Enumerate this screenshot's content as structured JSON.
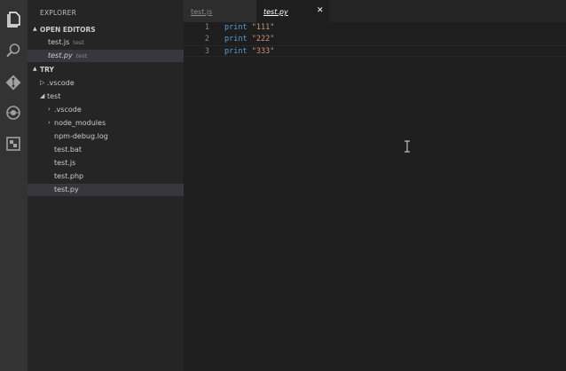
{
  "explorer": {
    "title": "EXPLORER",
    "open_editors_label": "OPEN EDITORS",
    "open_editors": [
      {
        "name": "test.js",
        "folder": "test"
      },
      {
        "name": "test.py",
        "folder": "test"
      }
    ],
    "workspace_label": "TRY",
    "tree": {
      "vscode_root": ".vscode",
      "test_folder": "test",
      "vscode_sub": ".vscode",
      "node_modules": "node_modules",
      "files": [
        "npm-debug.log",
        "test.bat",
        "test.js",
        "test.php",
        "test.py"
      ]
    }
  },
  "tabs": [
    {
      "label": "test.js"
    },
    {
      "label": "test.py"
    }
  ],
  "editor": {
    "lines": [
      {
        "num": "1",
        "keyword": "print",
        "string": "\"111\""
      },
      {
        "num": "2",
        "keyword": "print",
        "string": "\"222\""
      },
      {
        "num": "3",
        "keyword": "print",
        "string": "\"333\""
      }
    ]
  },
  "icons": {
    "activity": [
      "files-icon",
      "search-icon",
      "git-icon",
      "debug-icon",
      "extensions-icon"
    ]
  },
  "colors": {
    "keyword": "#569cd6",
    "string": "#ce9178",
    "activity_bar": "#333333",
    "sidebar": "#252526",
    "editor": "#1e1e1e"
  }
}
